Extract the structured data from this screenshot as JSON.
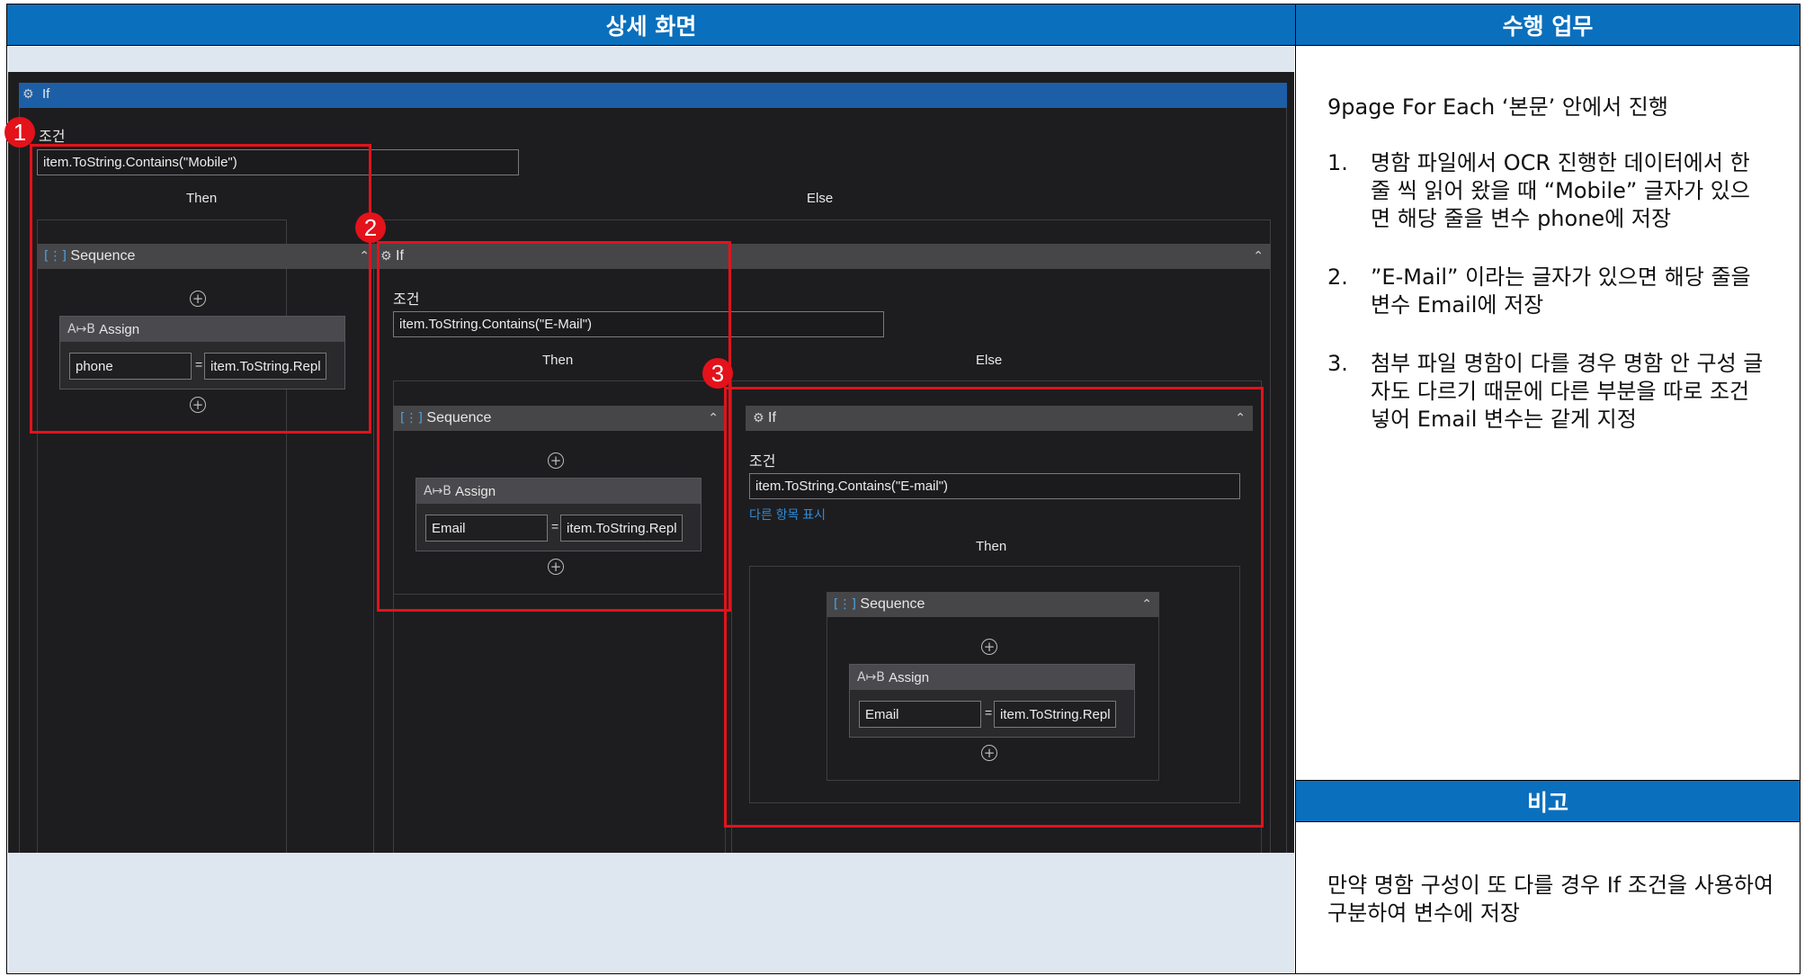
{
  "table": {
    "header_left": "상세 화면",
    "header_right": "수행 업무",
    "header_note": "비고",
    "task_intro": "9page For Each ‘본문’ 안에서 진행",
    "task_items": [
      {
        "num": "1.",
        "text": "명함 파일에서 OCR 진행한 데이터에서 한 줄 씩 읽어 왔을 때 “Mobile” 글자가 있으면 해당 줄을 변수 phone에 저장"
      },
      {
        "num": "2.",
        "text": "”E-Mail” 이라는 글자가 있으면 해당 줄을 변수 Email에 저장"
      },
      {
        "num": "3.",
        "text": "첨부 파일 명함이 다를 경우 명함 안 구성 글자도 다르기 때문에 다른 부분을 따로 조건 넣어 Email 변수는 같게 지정"
      }
    ],
    "note_text": "만약 명함 구성이 또 다를 경우 If 조건을 사용하여 구분하여 변수에 저장"
  },
  "workflow": {
    "top_if_label": "If",
    "cond_label": "조건",
    "then_label": "Then",
    "else_label": "Else",
    "sequence_label": "Sequence",
    "assign_label": "Assign",
    "if1": {
      "condition": "item.ToString.Contains(\"Mobile\")",
      "assign_to": "phone",
      "assign_value": "item.ToString.Repl"
    },
    "if2": {
      "label": "If",
      "condition": "item.ToString.Contains(\"E-Mail\")",
      "assign_to": "Email",
      "assign_value": "item.ToString.Repl"
    },
    "if3": {
      "label": "If",
      "condition": "item.ToString.Contains(\"E-mail\")",
      "more_link": "다른 항목 표시",
      "assign_to": "Email",
      "assign_value": "item.ToString.Repl"
    }
  },
  "annotations": [
    "1",
    "2",
    "3"
  ],
  "colors": {
    "header_blue": "#0a6fbd",
    "highlight_red": "#e3121b",
    "light_band": "#dee7f0"
  }
}
